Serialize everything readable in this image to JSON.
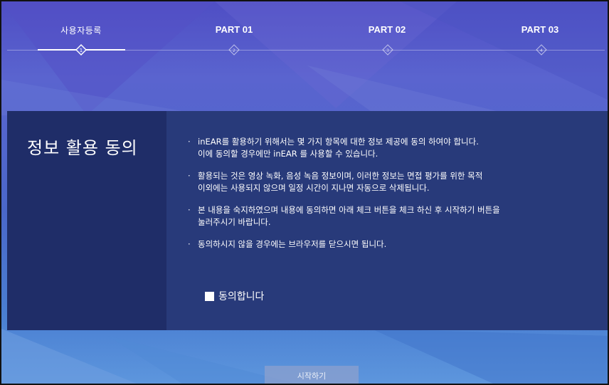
{
  "steps": [
    {
      "label": "사용자등록",
      "number": "1",
      "active": true
    },
    {
      "label": "PART 01",
      "number": "2",
      "active": false
    },
    {
      "label": "PART 02",
      "number": "3",
      "active": false
    },
    {
      "label": "PART 03",
      "number": "4",
      "active": false
    }
  ],
  "panel": {
    "title": "정보 활용 동의",
    "bullets": [
      {
        "lines": [
          "inEAR를 활용하기 위해서는 몇 가지 항목에 대한 정보 제공에 동의 하여야 합니다.",
          "이에 동의할 경우에만 inEAR 를 사용할 수 있습니다."
        ]
      },
      {
        "lines": [
          "활용되는 것은 영상 녹화, 음성 녹음 정보이며, 이러한 정보는 면접 평가를 위한 목적",
          "이외에는 사용되지 않으며 일정 시간이 지나면 자동으로 삭제됩니다."
        ]
      },
      {
        "lines": [
          "본 내용을 숙지하였으며 내용에 동의하면 아래 체크 버튼을 체크 하신 후 시작하기 버튼을",
          "눌러주시기 바랍니다."
        ]
      },
      {
        "lines": [
          "동의하시지 않을 경우에는 브라우저를 닫으시면 됩니다."
        ]
      }
    ],
    "bullet_marker": "·",
    "agree_label": "동의합니다",
    "agree_checked": false
  },
  "start_button": {
    "label": "시작하기"
  },
  "colors": {
    "panel_left": "#1f2d68",
    "panel_right": "#283a7a",
    "accent": "#ffffff"
  }
}
